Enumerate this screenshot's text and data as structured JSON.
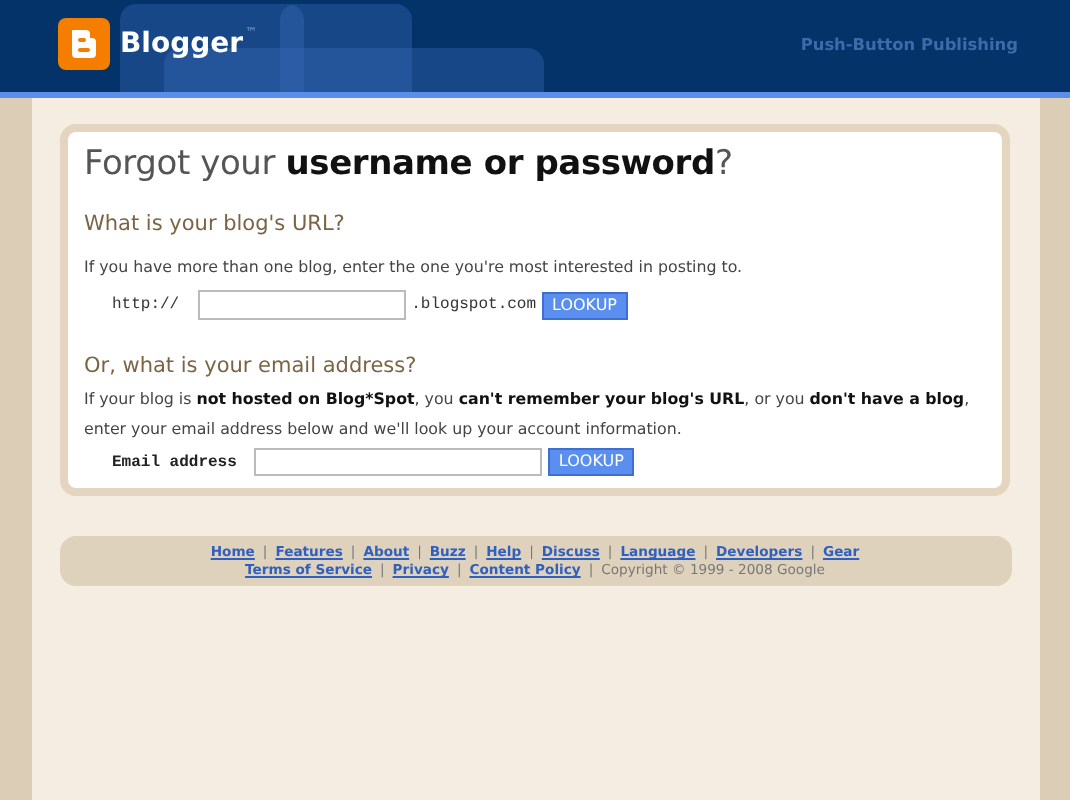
{
  "header": {
    "brand": "Blogger",
    "trademark": "™",
    "tagline": "Push-Button Publishing"
  },
  "card": {
    "title": "Forgot your **username or password**?",
    "url_section": {
      "heading": "What is your blog's URL?",
      "text": "If you have more than one blog, enter the one you're most interested in posting to.",
      "prefix": "http://",
      "suffix": ".blogspot.com",
      "button": "LOOKUP"
    },
    "email_section": {
      "heading": "Or, what is your email address?",
      "text": "If your blog is **not hosted on Blog*Spot**, you **can't remember your blog's URL**, or you **don't have a blog**, enter your email address below and we'll look up your account information.",
      "label": "Email address",
      "button": "LOOKUP"
    }
  },
  "footer": {
    "separator": "|",
    "nav_links": [
      "Home",
      "Features",
      "About",
      "Buzz",
      "Help",
      "Discuss",
      "Language",
      "Developers",
      "Gear"
    ],
    "legal_links": [
      "Terms of Service",
      "Privacy",
      "Content Policy"
    ],
    "copyright": "Copyright © 1999 - 2008 Google"
  }
}
